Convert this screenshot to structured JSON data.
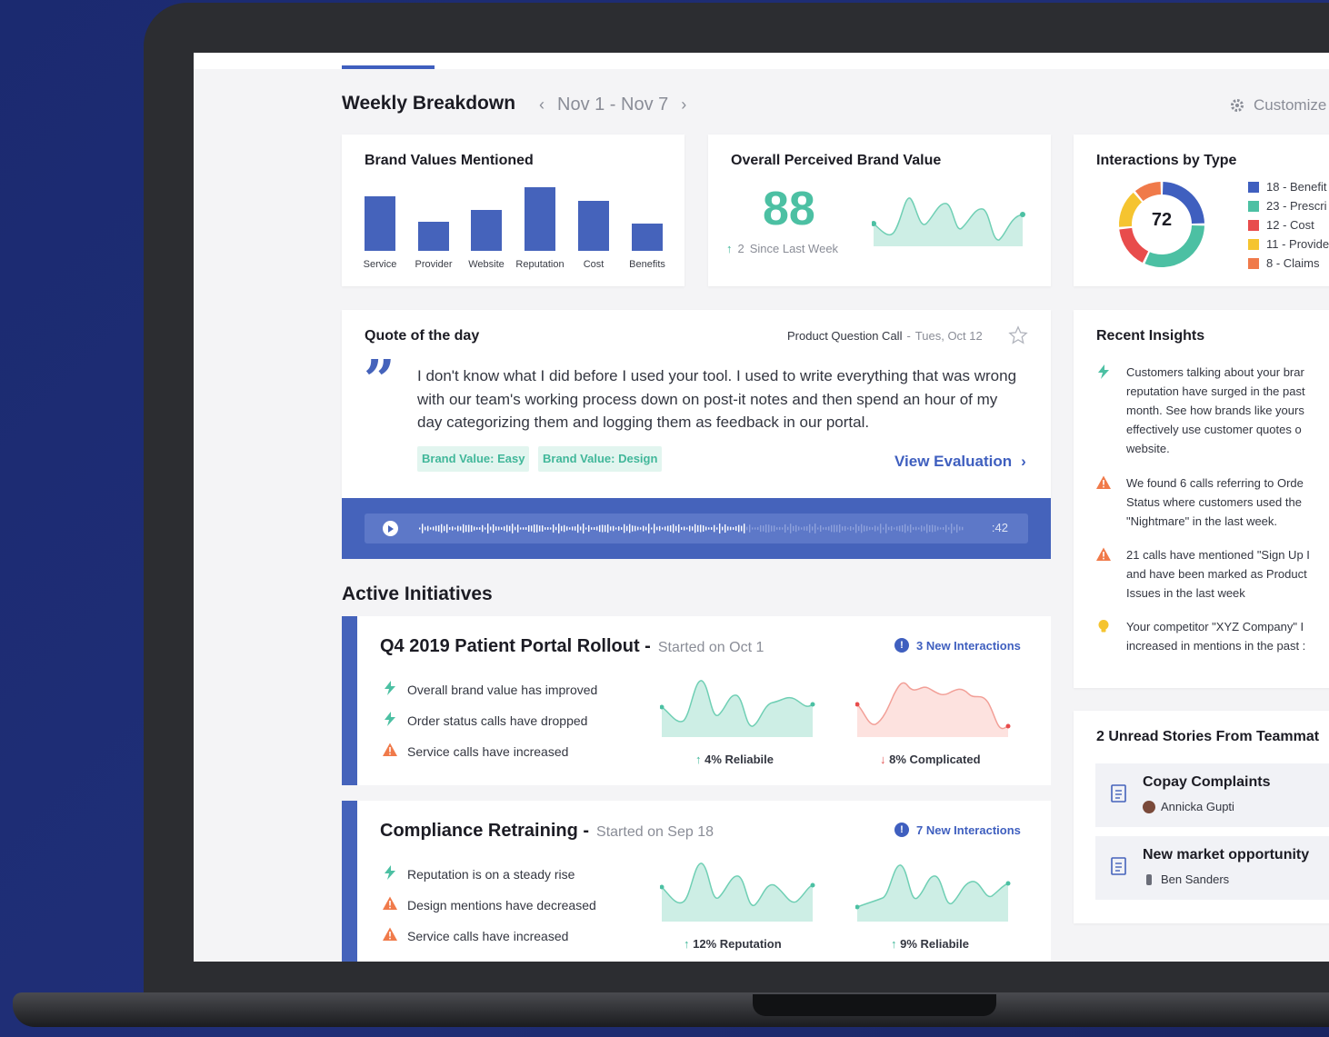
{
  "header": {
    "title": "Weekly Breakdown",
    "date_range": "Nov 1 - Nov 7",
    "customize_label": "Customize"
  },
  "brand_values": {
    "title": "Brand Values Mentioned",
    "chart_data": {
      "type": "bar",
      "categories": [
        "Service",
        "Provider",
        "Website",
        "Reputation",
        "Cost",
        "Benefits"
      ],
      "values": [
        60,
        32,
        45,
        70,
        55,
        30
      ]
    }
  },
  "perceived_value": {
    "title": "Overall Perceived Brand Value",
    "score": "88",
    "delta": "2",
    "delta_label": "Since Last Week"
  },
  "interactions": {
    "title": "Interactions by Type",
    "total": "72",
    "items": [
      {
        "label": "18 - Benefit",
        "color": "#3f5fbf",
        "value": 18
      },
      {
        "label": "23 - Prescri",
        "color": "#4cc0a3",
        "value": 23
      },
      {
        "label": "12 - Cost",
        "color": "#e84c4c",
        "value": 12
      },
      {
        "label": "11 - Provide",
        "color": "#f5c430",
        "value": 11
      },
      {
        "label": "8 - Claims",
        "color": "#f07a4a",
        "value": 8
      }
    ]
  },
  "quote": {
    "title": "Quote of the day",
    "source": "Product Question Call",
    "date": "Tues, Oct 12",
    "text": "I don't know what I did before I used your tool. I used to write everything that was wrong with our team's working process down on post-it notes and then spend an hour of my day categorizing them and logging them as feedback in our portal.",
    "tags": [
      "Brand Value: Easy",
      "Brand Value: Design"
    ],
    "view_label": "View Evaluation",
    "duration": ":42",
    "played_fraction": 0.6
  },
  "initiatives": {
    "title": "Active Initiatives",
    "items": [
      {
        "name": "Q4 2019 Patient Portal Rollout -",
        "started": "Started on Oct 1",
        "new_interactions": "3 New Interactions",
        "rows": [
          {
            "icon": "bolt",
            "text": "Overall brand value has improved"
          },
          {
            "icon": "bolt",
            "text": "Order status calls have dropped"
          },
          {
            "icon": "warning",
            "text": "Service calls have increased"
          }
        ],
        "metrics": [
          {
            "direction": "up",
            "text": "4% Reliabile"
          },
          {
            "direction": "down",
            "text": "8% Complicated"
          }
        ]
      },
      {
        "name": "Compliance Retraining -",
        "started": "Started on Sep 18",
        "new_interactions": "7 New Interactions",
        "rows": [
          {
            "icon": "bolt",
            "text": "Reputation is on a steady rise"
          },
          {
            "icon": "warning",
            "text": "Design mentions have decreased"
          },
          {
            "icon": "warning",
            "text": "Service calls have increased"
          }
        ],
        "metrics": [
          {
            "direction": "up",
            "text": "12% Reputation"
          },
          {
            "direction": "up",
            "text": "9% Reliabile"
          }
        ]
      }
    ]
  },
  "insights": {
    "title": "Recent Insights",
    "items": [
      {
        "icon": "bolt",
        "text": "Customers talking about your brar reputation have surged in the past month. See how brands like yours effectively use customer quotes o website."
      },
      {
        "icon": "warning",
        "text": "We found 6 calls referring to Orde Status where customers used the \"Nightmare\" in the last week."
      },
      {
        "icon": "warning",
        "text": "21 calls have mentioned \"Sign Up I and have been marked as Product Issues in the last week"
      },
      {
        "icon": "bulb",
        "text": "Your competitor \"XYZ Company\" I increased in mentions in the past :"
      }
    ]
  },
  "stories": {
    "title": "2 Unread Stories From Teammat",
    "items": [
      {
        "title": "Copay Complaints",
        "author": "Annicka Gupti"
      },
      {
        "title": "New market opportunity",
        "author": "Ben Sanders"
      }
    ]
  }
}
